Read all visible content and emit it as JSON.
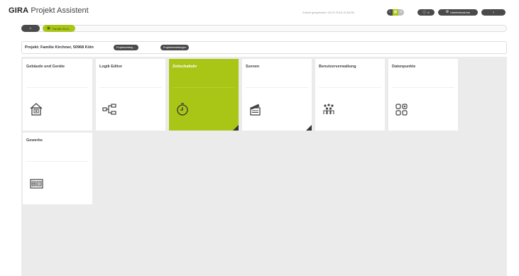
{
  "app": {
    "brand": "GIRA",
    "product": "Projekt Assistent"
  },
  "toolbar": {
    "saved_text": "Zuletzt gespeichert: 28.07.2016 15:54:38",
    "btn_info_label": "6",
    "btn_user_label": "Inbetriebnahme",
    "btn_help_label": "?"
  },
  "nav": {
    "breadcrumb": "Familie Kirch..."
  },
  "project": {
    "title": "Projekt: Familie Kirchner, 50968 Köln",
    "btn_scope": "Projektumfang ...",
    "btn_settings": "Projekteinstellungen"
  },
  "tiles": [
    {
      "label": "Gebäude und Geräte",
      "icon": "building-icon",
      "active": false
    },
    {
      "label": "Logik Editor",
      "icon": "logic-icon",
      "active": false
    },
    {
      "label": "Zeitschaltuhr",
      "icon": "timer-icon",
      "active": true
    },
    {
      "label": "Szenen",
      "icon": "scene-icon",
      "active": false
    },
    {
      "label": "Benutzerverwaltung",
      "icon": "users-icon",
      "active": false
    },
    {
      "label": "Datenpunkte",
      "icon": "datapoints-icon",
      "active": false
    },
    {
      "label": "Gewerke",
      "icon": "trades-icon",
      "active": false
    }
  ],
  "colors": {
    "accent": "#a9c617",
    "dark": "#4a4a4a",
    "background": "#ebebeb"
  }
}
